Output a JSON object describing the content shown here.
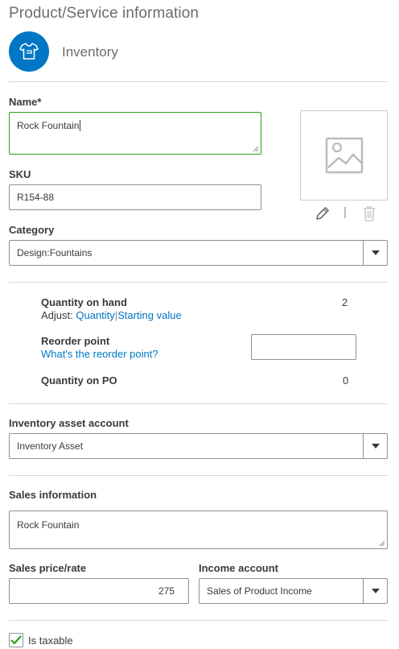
{
  "header": {
    "title": "Product/Service information",
    "type_label": "Inventory"
  },
  "name": {
    "label": "Name*",
    "value": "Rock Fountain"
  },
  "sku": {
    "label": "SKU",
    "value": "R154-88"
  },
  "category": {
    "label": "Category",
    "value": "Design:Fountains"
  },
  "image_actions": {
    "separator": "|"
  },
  "quantity": {
    "on_hand_label": "Quantity on hand",
    "on_hand_value": "2",
    "adjust_prefix": "Adjust:",
    "adjust_quantity_link": "Quantity",
    "separator": "|",
    "starting_value_link": "Starting value",
    "reorder_label": "Reorder point",
    "reorder_help_link": "What's the reorder point?",
    "reorder_value": "",
    "on_po_label": "Quantity on PO",
    "on_po_value": "0"
  },
  "inventory_asset": {
    "label": "Inventory asset account",
    "value": "Inventory Asset"
  },
  "sales": {
    "label": "Sales information",
    "description": "Rock Fountain",
    "price_label": "Sales price/rate",
    "price_value": "275",
    "income_label": "Income account",
    "income_value": "Sales of Product Income"
  },
  "taxable": {
    "label": "Is taxable",
    "checked": true
  },
  "colors": {
    "accent_blue": "#0077c5",
    "focus_green": "#2ca01c"
  }
}
